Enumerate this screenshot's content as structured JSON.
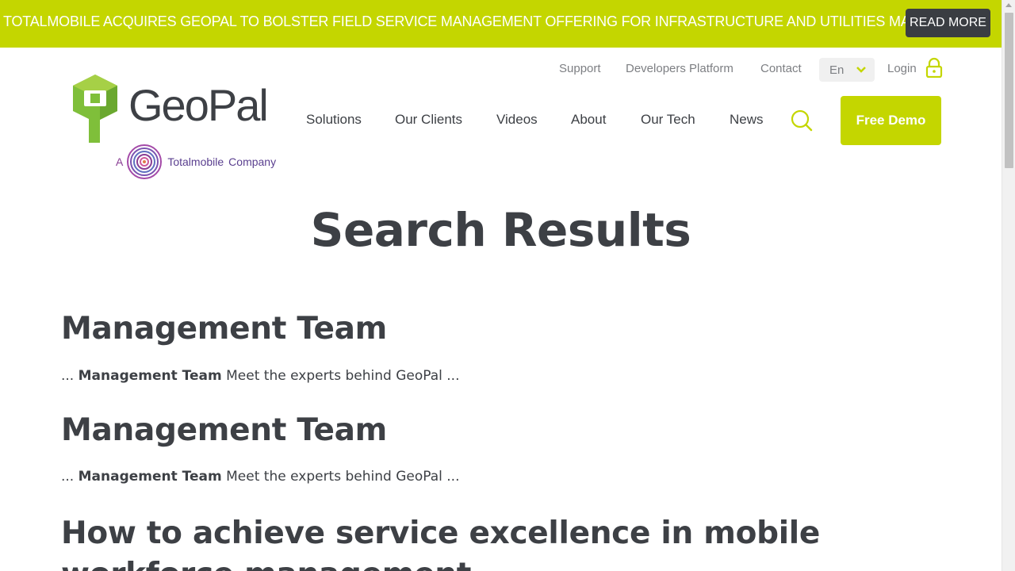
{
  "announcement": {
    "text": "TOTALMOBILE ACQUIRES GEOPAL TO BOLSTER FIELD SERVICE MANAGEMENT OFFERING FOR INFRASTRUCTURE AND UTILITIES MARKETS",
    "button_label": "READ MORE"
  },
  "logo": {
    "wordmark": "GeoPal",
    "tagline_prefix": "A",
    "tagline_brand": "Totalmobile",
    "tagline_suffix": "Company"
  },
  "utility_nav": {
    "support": "Support",
    "developers": "Developers Platform",
    "contact": "Contact",
    "language": "En",
    "login": "Login"
  },
  "main_nav": {
    "items": [
      "Solutions",
      "Our Clients",
      "Videos",
      "About",
      "Our Tech",
      "News"
    ],
    "demo_button": "Free Demo"
  },
  "page": {
    "title": "Search Results"
  },
  "results": [
    {
      "title": "Management Team",
      "snippet_prefix": "...",
      "snippet_bold": "Management Team",
      "snippet_rest": "Meet the experts behind GeoPal ..."
    },
    {
      "title": "Management Team",
      "snippet_prefix": "...",
      "snippet_bold": "Management Team",
      "snippet_rest": "Meet the experts behind GeoPal ..."
    },
    {
      "title": "How to achieve service excellence in mobile workforce management"
    }
  ],
  "colors": {
    "brand_green": "#c4d600",
    "dark_text": "#3d4045",
    "button_dark": "#3a3d42",
    "muted_text": "#7d7f83",
    "purple": "#8a3f95"
  }
}
